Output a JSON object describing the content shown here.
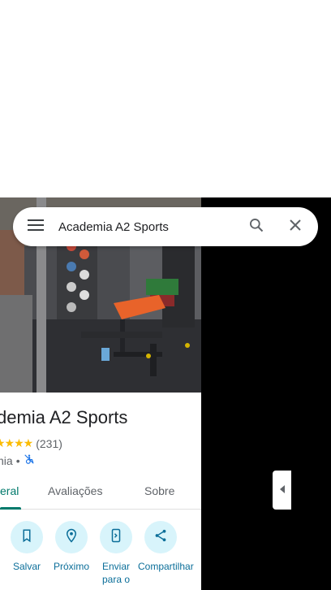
{
  "search": {
    "query": "Academia A2 Sports"
  },
  "place": {
    "title": "demia A2 Sports",
    "stars": "★★★★",
    "rating_count": "(231)",
    "category": "nia",
    "separator": "•"
  },
  "tabs": [
    {
      "label": "eral",
      "active": true
    },
    {
      "label": "Avaliações",
      "active": false
    },
    {
      "label": "Sobre",
      "active": false
    }
  ],
  "actions": [
    {
      "label": "Salvar",
      "icon": "bookmark-icon"
    },
    {
      "label": "Próximo",
      "icon": "nearby-icon"
    },
    {
      "label": "Enviar para o",
      "icon": "send-to-phone-icon"
    },
    {
      "label": "Compartilhar",
      "icon": "share-icon"
    }
  ],
  "colors": {
    "accent": "#00796b",
    "action_circle": "#d8f4fb",
    "action_label": "#0b6e99",
    "star": "#fbbc04"
  }
}
